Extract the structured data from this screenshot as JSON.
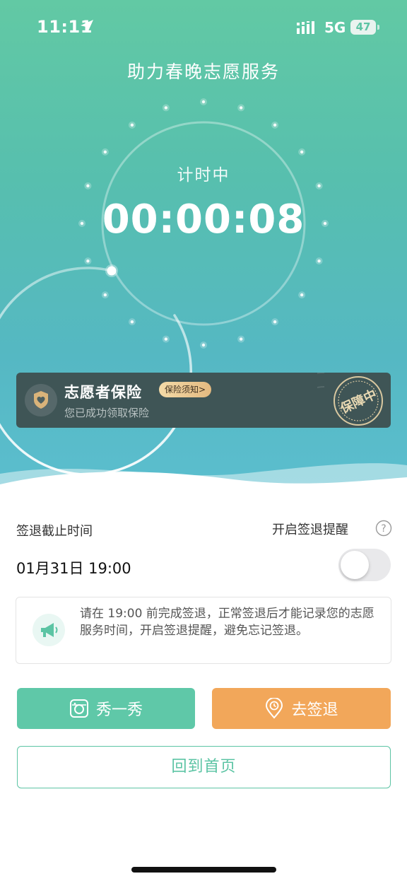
{
  "status_bar": {
    "time": "11:11",
    "network": "5G",
    "battery": "47"
  },
  "page": {
    "title": "助力春晚志愿服务"
  },
  "timer": {
    "status": "计时中",
    "elapsed": "00:00:08",
    "progress": 0.02
  },
  "insurance": {
    "title": "志愿者保险",
    "notice_link": "保险须知>",
    "subtitle": "您已成功领取保险",
    "stamp": "保障中"
  },
  "checkout": {
    "deadline_label": "签退截止时间",
    "reminder_label": "开启签退提醒",
    "deadline": "01月31日 19:00",
    "reminder_on": false
  },
  "notice": {
    "text": "请在 19:00 前完成签退，正常签退后才能记录您的志愿服务时间，开启签退提醒，避免忘记签退。"
  },
  "actions": {
    "show_label": "秀一秀",
    "checkout_label": "去签退",
    "home_label": "回到首页"
  },
  "colors": {
    "primary": "#5cc4a4",
    "orange": "#f2a75a",
    "card_dark": "#3f5556"
  }
}
